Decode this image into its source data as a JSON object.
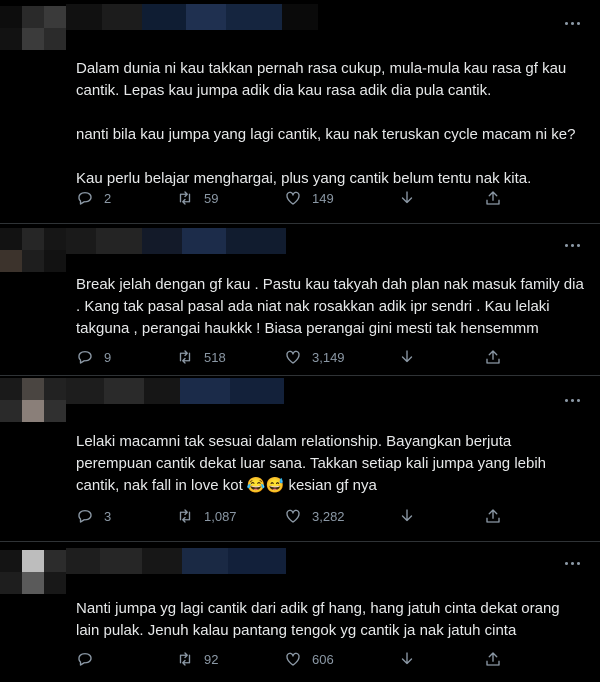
{
  "tweets": [
    {
      "text": "Dalam dunia ni kau takkan pernah rasa cukup, mula-mula kau rasa gf kau cantik. Lepas kau jumpa adik dia kau rasa adik dia pula cantik.\n\nnanti bila kau jumpa yang lagi cantik, kau nak teruskan cycle macam ni ke?\n\nKau perlu belajar menghargai, plus yang cantik belum tentu nak kita.",
      "replies": "2",
      "retweets": "59",
      "likes": "149"
    },
    {
      "text": "Break jelah dengan gf kau . Pastu kau takyah dah plan nak masuk family dia . Kang tak pasal pasal ada niat nak rosakkan adik ipr sendri . Kau lelaki takguna , perangai haukkk ! Biasa perangai gini mesti tak hensemmm",
      "replies": "9",
      "retweets": "518",
      "likes": "3,149"
    },
    {
      "text": "Lelaki macamni tak sesuai dalam relationship. Bayangkan berjuta perempuan cantik dekat luar sana. Takkan setiap kali jumpa yang lebih cantik, nak fall in love kot 😂😅 kesian gf nya",
      "replies": "3",
      "retweets": "1,087",
      "likes": "3,282"
    },
    {
      "text": "Nanti jumpa yg lagi cantik dari adik gf hang, hang jatuh cinta dekat orang lain pulak. Jenuh kalau pantang tengok yg cantik ja nak jatuh cinta",
      "replies": "",
      "retweets": "92",
      "likes": "606"
    }
  ],
  "icons": {
    "more": "more-icon",
    "reply": "reply-icon",
    "retweet": "retweet-icon",
    "like": "heart-icon",
    "download": "download-icon",
    "share": "share-icon"
  },
  "colors": {
    "background": "#000000",
    "text": "#e7e9ea",
    "muted": "#8b98a5",
    "divider": "#2f3336"
  }
}
